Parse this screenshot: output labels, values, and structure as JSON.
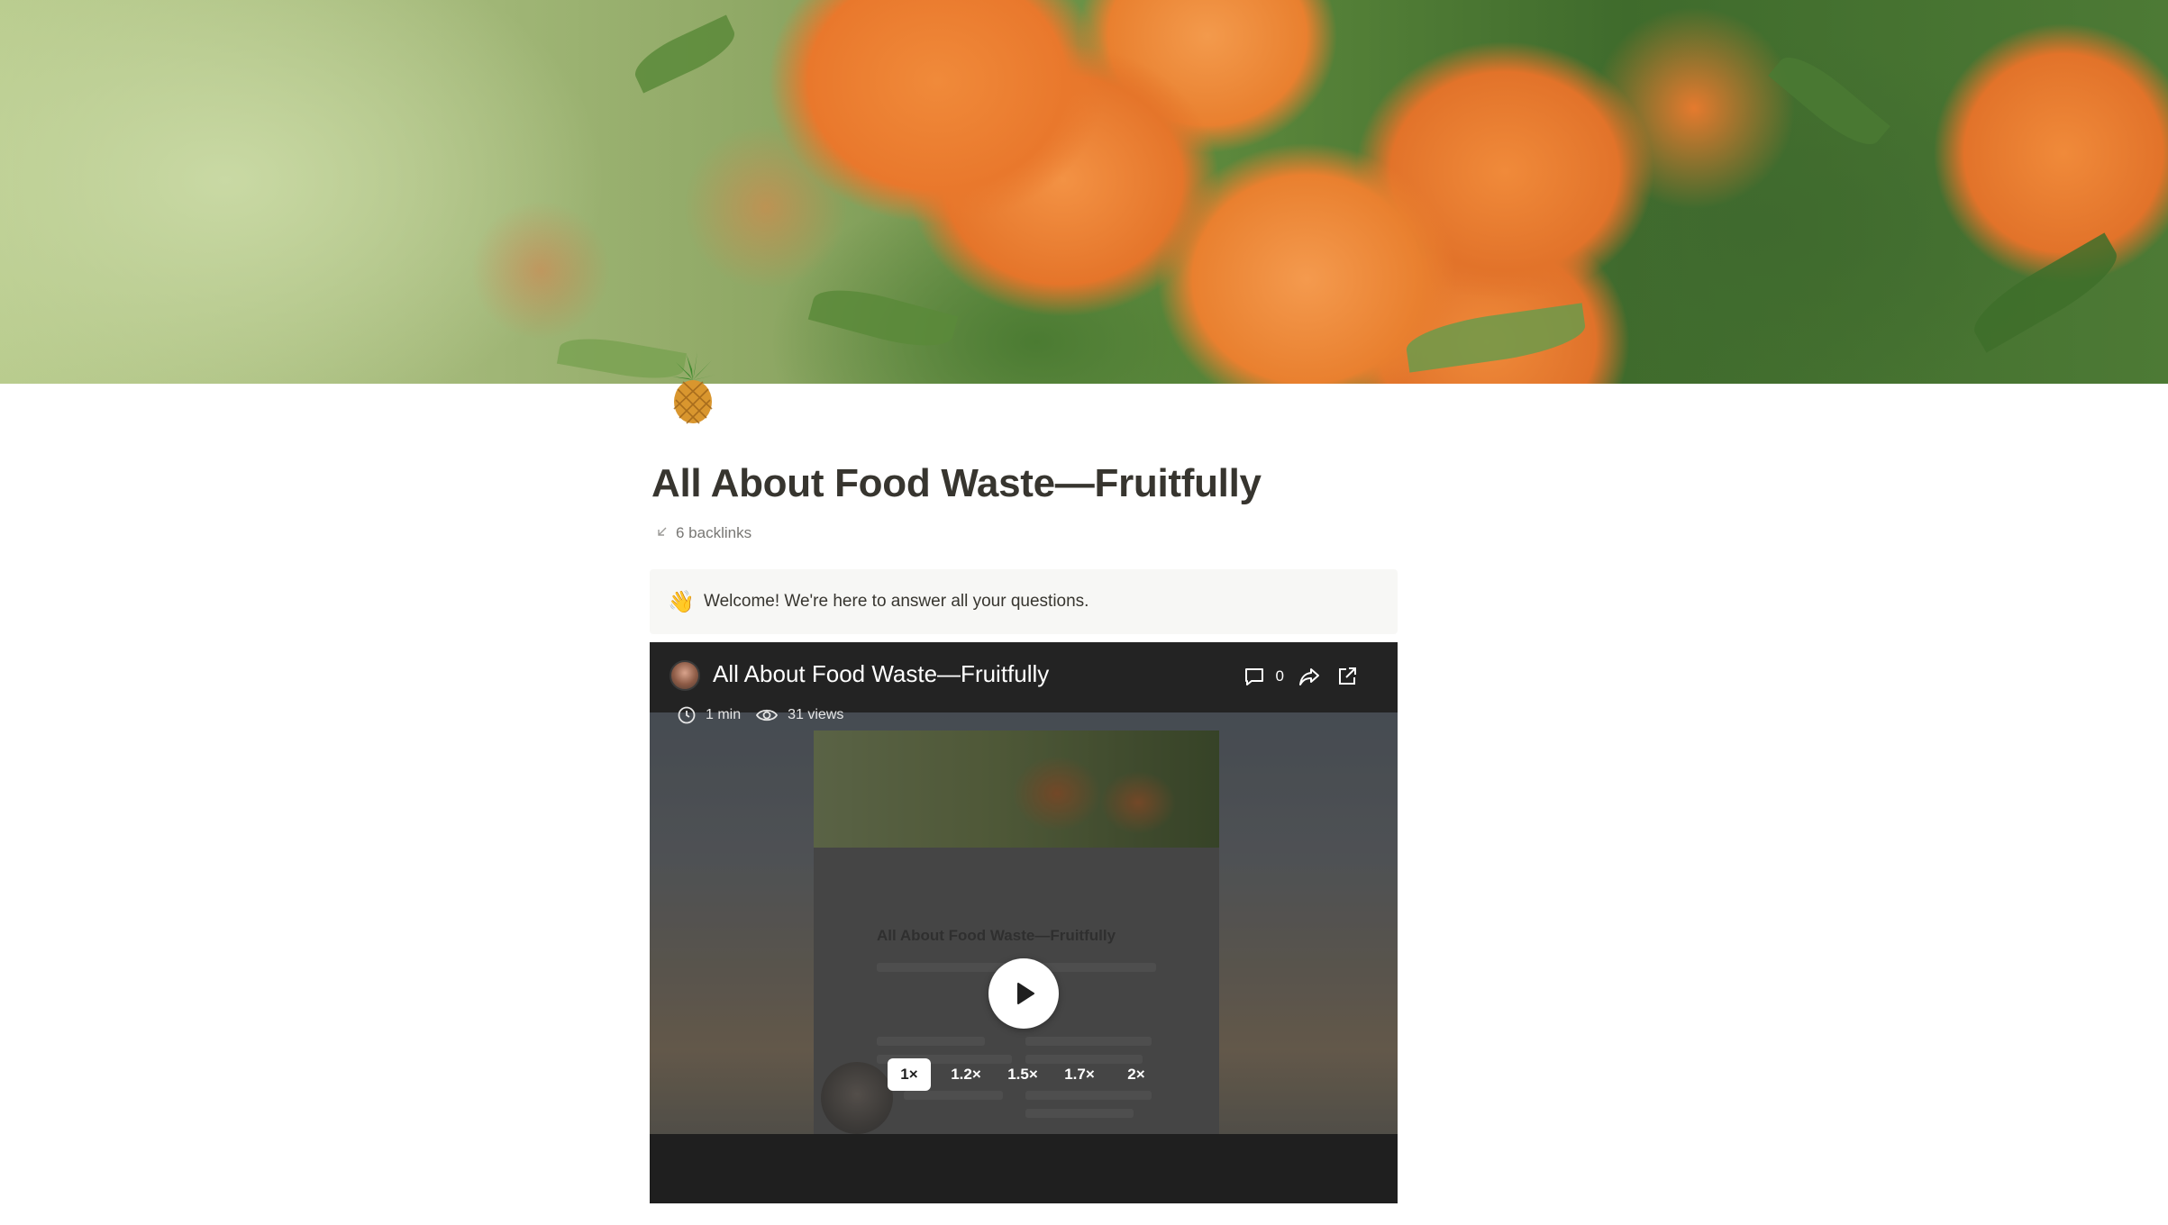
{
  "page": {
    "title": "All About Food Waste—Fruitfully",
    "icon": "pineapple-icon",
    "backlinks_label": "6 backlinks"
  },
  "callout": {
    "emoji": "👋",
    "text": "Welcome! We're here to answer all your questions."
  },
  "video": {
    "title": "All About Food Waste—Fruitfully",
    "duration": "1 min",
    "views": "31 views",
    "comment_count": "0",
    "preview_title": "All About Food Waste—Fruitfully",
    "speeds": [
      "1×",
      "1.2×",
      "1.5×",
      "1.7×",
      "2×"
    ],
    "active_speed": "1×"
  },
  "colors": {
    "text": "#37352f",
    "muted": "#787774",
    "callout_bg": "#f7f7f5",
    "video_bg": "#1f1f1f"
  }
}
